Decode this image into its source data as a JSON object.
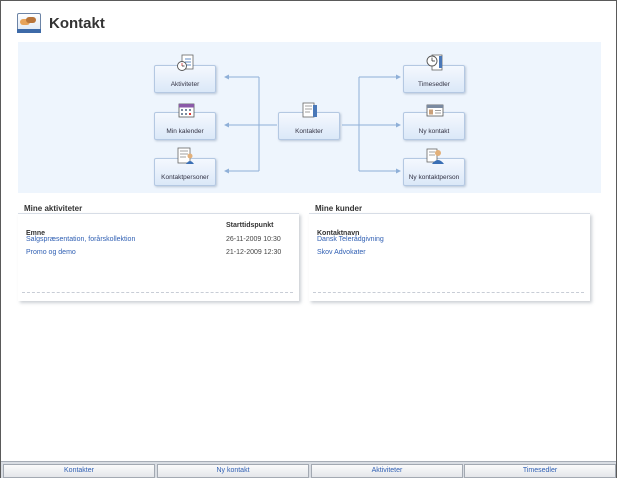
{
  "header": {
    "title": "Kontakt"
  },
  "diagram": {
    "left_nodes": [
      {
        "label": "Aktiviteter",
        "icon": "clipboard-clock-icon"
      },
      {
        "label": "Min kalender",
        "icon": "calendar-icon"
      },
      {
        "label": "Kontaktpersoner",
        "icon": "person-list-icon"
      }
    ],
    "center_node": {
      "label": "Kontakter",
      "icon": "contacts-list-icon"
    },
    "right_nodes": [
      {
        "label": "Timesedler",
        "icon": "timesheet-clock-icon"
      },
      {
        "label": "Ny kontakt",
        "icon": "contact-card-icon"
      },
      {
        "label": "Ny kontaktperson",
        "icon": "new-person-icon"
      }
    ],
    "accent": "#eef5fd"
  },
  "activities": {
    "title": "Mine aktiviteter",
    "columns": [
      "Emne",
      "Starttidspunkt"
    ],
    "rows": [
      {
        "subject": "Salgspræsentation, forårskollektion",
        "start": "26-11-2009 10:30"
      },
      {
        "subject": "Promo og demo",
        "start": "21-12-2009 12:30"
      }
    ]
  },
  "customers": {
    "title": "Mine kunder",
    "column": "Kontaktnavn",
    "rows": [
      "Dansk Telerådgivning",
      "Skov Advokater"
    ]
  },
  "footer": {
    "buttons": [
      "Kontakter",
      "Ny kontakt",
      "Aktiviteter",
      "Timesedler"
    ]
  },
  "colors": {
    "link": "#2f5fb3",
    "frame_border": "#5a5a5a"
  }
}
